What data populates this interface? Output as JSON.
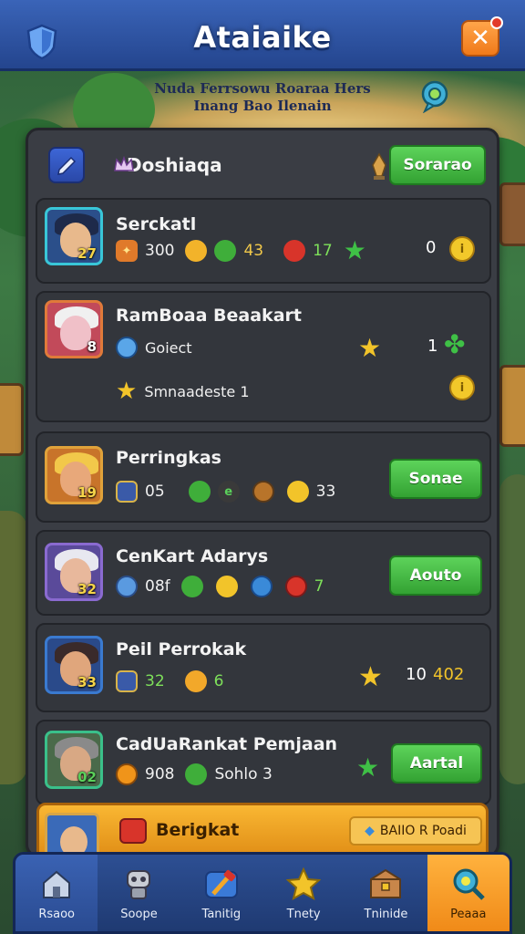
{
  "header": {
    "title": "Ataiaike",
    "subtitle_line1": "Nuda Ferrsowu Roaraa Hers",
    "subtitle_line2": "Inang Bao Ilenain",
    "close_label": "✕"
  },
  "panel": {
    "title": "Doshiaqa",
    "action_label": "Sorarao"
  },
  "cards": [
    {
      "name": "Serckatl",
      "level": "27",
      "stats": [
        "300",
        "43",
        "17"
      ],
      "right_value": "0"
    },
    {
      "name": "RamBoaa Beaakart",
      "level": "8",
      "sub": "Goiect",
      "right_value": "1",
      "line2": "Smnaadeste 1"
    },
    {
      "name": "Perringkas",
      "level": "19",
      "stats": [
        "05",
        "33"
      ],
      "action_label": "Sonae"
    },
    {
      "name": "CenKart Adarys",
      "level": "32",
      "stats": [
        "08f",
        "7"
      ],
      "action_label": "Aouto"
    },
    {
      "name": "Peil Perrokak",
      "level": "33",
      "stats": [
        "32",
        "6"
      ],
      "right_value": "10",
      "right_value2": "402"
    },
    {
      "name": "CadUaRankat Pemjaan",
      "level": "02",
      "stats": [
        "908",
        "Sohlo 3"
      ],
      "action_label": "Aartal"
    }
  ],
  "highlight": {
    "name": "Berigkat",
    "badge": "BAIIO R Poadi"
  },
  "nav": [
    {
      "label": "Rsaoo",
      "icon": "home-icon"
    },
    {
      "label": "Soope",
      "icon": "robot-icon"
    },
    {
      "label": "Tanitig",
      "icon": "hammer-icon"
    },
    {
      "label": "Tnety",
      "icon": "star-icon"
    },
    {
      "label": "Tninide",
      "icon": "chest-icon"
    },
    {
      "label": "Peaaa",
      "icon": "search-icon"
    }
  ]
}
